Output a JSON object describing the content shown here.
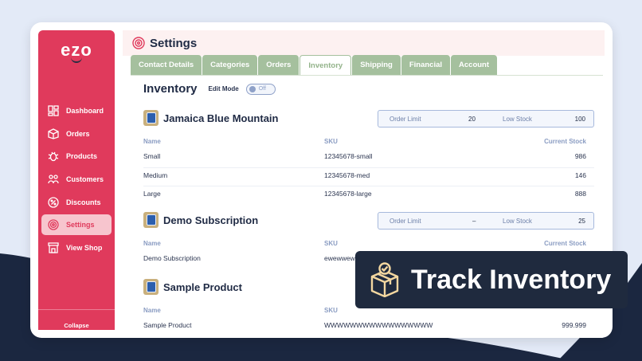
{
  "app": {
    "logo": "ezo"
  },
  "sidebar": {
    "items": [
      {
        "label": "Dashboard",
        "icon": "dashboard-icon"
      },
      {
        "label": "Orders",
        "icon": "box-icon"
      },
      {
        "label": "Products",
        "icon": "bug-icon"
      },
      {
        "label": "Customers",
        "icon": "customers-icon"
      },
      {
        "label": "Discounts",
        "icon": "percent-icon"
      },
      {
        "label": "Settings",
        "icon": "settings-icon",
        "active": true
      },
      {
        "label": "View Shop",
        "icon": "shop-icon"
      }
    ],
    "collapse_label": "Collapse"
  },
  "header": {
    "title": "Settings"
  },
  "tabs": [
    {
      "label": "Contact Details"
    },
    {
      "label": "Categories"
    },
    {
      "label": "Orders"
    },
    {
      "label": "Inventory",
      "active": true
    },
    {
      "label": "Shipping"
    },
    {
      "label": "Financial"
    },
    {
      "label": "Account"
    }
  ],
  "inventory": {
    "title": "Inventory",
    "edit_mode_label": "Edit Mode",
    "toggle_label": "Off",
    "columns": {
      "name": "Name",
      "sku": "SKU",
      "stock": "Current Stock"
    },
    "limit_labels": {
      "order_limit": "Order Limit",
      "low_stock": "Low Stock"
    },
    "products": [
      {
        "name": "Jamaica Blue Mountain",
        "order_limit": "20",
        "low_stock": "100",
        "rows": [
          {
            "name": "Small",
            "sku": "12345678-small",
            "stock": "986"
          },
          {
            "name": "Medium",
            "sku": "12345678-med",
            "stock": "146"
          },
          {
            "name": "Large",
            "sku": "12345678-large",
            "stock": "888"
          }
        ]
      },
      {
        "name": "Demo Subscription",
        "order_limit": "–",
        "low_stock": "25",
        "rows": [
          {
            "name": "Demo Subscription",
            "sku": "ewewwew",
            "stock": ""
          }
        ]
      },
      {
        "name": "Sample Product",
        "rows": [
          {
            "name": "Sample Product",
            "sku": "WWWWWWWWWWWWWWWWW",
            "stock": "999.999"
          }
        ]
      }
    ]
  },
  "badge": {
    "text": "Track Inventory",
    "icon": "package-check-icon"
  },
  "colors": {
    "brand": "#e03a5c",
    "tab_green": "#a5c09e",
    "dark_navy": "#1f2a3e",
    "background": "#e3eaf7"
  }
}
